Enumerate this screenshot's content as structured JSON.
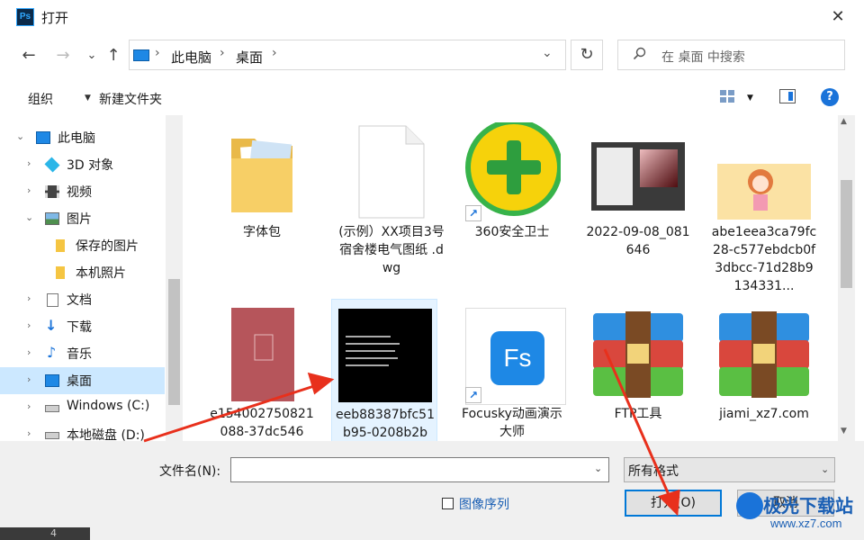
{
  "window": {
    "title": "打开",
    "app_icon_text": "Ps",
    "close": "✕"
  },
  "nav": {
    "back": "←",
    "forward": "→",
    "history": "⌄",
    "up": "↑",
    "breadcrumb": [
      "此电脑",
      "桌面"
    ],
    "refresh": "↻",
    "search_placeholder": "在 桌面 中搜索"
  },
  "toolbar": {
    "organize": "组织",
    "new_folder": "新建文件夹",
    "help": "?"
  },
  "sidebar": {
    "items": [
      {
        "label": "此电脑",
        "icon": "computer-icon",
        "expanded": true
      },
      {
        "label": "3D 对象",
        "icon": "cube-3d-icon"
      },
      {
        "label": "视频",
        "icon": "film-icon"
      },
      {
        "label": "图片",
        "icon": "picture-icon",
        "expanded": true
      },
      {
        "label": "保存的图片",
        "icon": "folder-icon"
      },
      {
        "label": "本机照片",
        "icon": "folder-icon"
      },
      {
        "label": "文档",
        "icon": "document-icon"
      },
      {
        "label": "下载",
        "icon": "download-icon"
      },
      {
        "label": "音乐",
        "icon": "music-icon"
      },
      {
        "label": "桌面",
        "icon": "desktop-icon",
        "selected": true
      },
      {
        "label": "Windows (C:)",
        "icon": "drive-icon"
      },
      {
        "label": "本地磁盘 (D:)",
        "icon": "drive-icon"
      }
    ]
  },
  "files": [
    {
      "name": "字体包",
      "type": "folder"
    },
    {
      "name": "(示例）XX项目3号宿舍楼电气图纸 .dwg",
      "type": "blank-file"
    },
    {
      "name": "360安全卫士",
      "type": "shortcut-360"
    },
    {
      "name": "2022-09-08_081646",
      "type": "screenshot"
    },
    {
      "name": "abe1eea3ca79fc28-c577ebdcb0f3dbcc-71d28b9134331...",
      "type": "illustration"
    },
    {
      "name": "e154002750821088-37dc546",
      "type": "red-image"
    },
    {
      "name": "eeb88387bfc51b95-0208b2b",
      "type": "black-image",
      "selected": true
    },
    {
      "name": "Focusky动画演示大师",
      "type": "shortcut-fs",
      "icon_text": "Fs"
    },
    {
      "name": "FTP工具",
      "type": "archive"
    },
    {
      "name": "jiami_xz7.com",
      "type": "archive"
    }
  ],
  "bottom": {
    "filename_label": "文件名(N):",
    "filename_value": "",
    "filetype": "所有格式",
    "image_sequence": "图像序列",
    "open": "打开(O)",
    "cancel": "取消"
  },
  "watermark": {
    "text": "极光下载站",
    "url": "www.xz7.com"
  },
  "taskbar": {
    "number": "4"
  },
  "colors": {
    "selection": "#cce8ff",
    "accent": "#0078d7",
    "arrow": "#e8301c"
  }
}
